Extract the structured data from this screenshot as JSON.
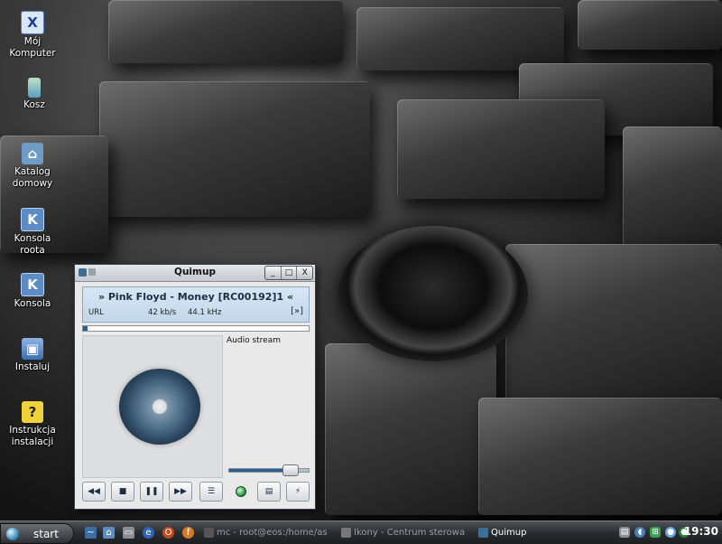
{
  "desktop": {
    "icons": [
      {
        "label": "Mój\nKomputer",
        "icon": "x-window-icon"
      },
      {
        "label": "Kosz",
        "icon": "trash-icon"
      },
      {
        "label": "Katalog\ndomowy",
        "icon": "home-folder-icon"
      },
      {
        "label": "Konsola\nroota",
        "icon": "root-console-icon"
      },
      {
        "label": "Konsola",
        "icon": "console-icon"
      },
      {
        "label": "Instaluj",
        "icon": "install-icon"
      },
      {
        "label": "Instrukcja\ninstalacji",
        "icon": "install-guide-icon"
      }
    ]
  },
  "player": {
    "window_title": "Quimup",
    "song": "» Pink Floyd - Money [RC00192]1 «",
    "source": "URL",
    "bitrate": "42 kb/s",
    "samplerate": "44.1 kHz",
    "more_button": "[»]",
    "stream_label": "Audio stream",
    "progress": 0.02,
    "volume": 0.78,
    "title_buttons": [
      "_",
      "□",
      "X"
    ]
  },
  "taskbar": {
    "start_label": "start",
    "tasks": [
      {
        "label": "mc - root@eos:/home/as",
        "active": false
      },
      {
        "label": "Ikony - Centrum sterowa",
        "active": false
      },
      {
        "label": "Quimup",
        "active": true
      }
    ],
    "clock": "19:30"
  },
  "colors": {
    "accent": "#2e5f8f",
    "info_panel": "#c9dcee"
  }
}
